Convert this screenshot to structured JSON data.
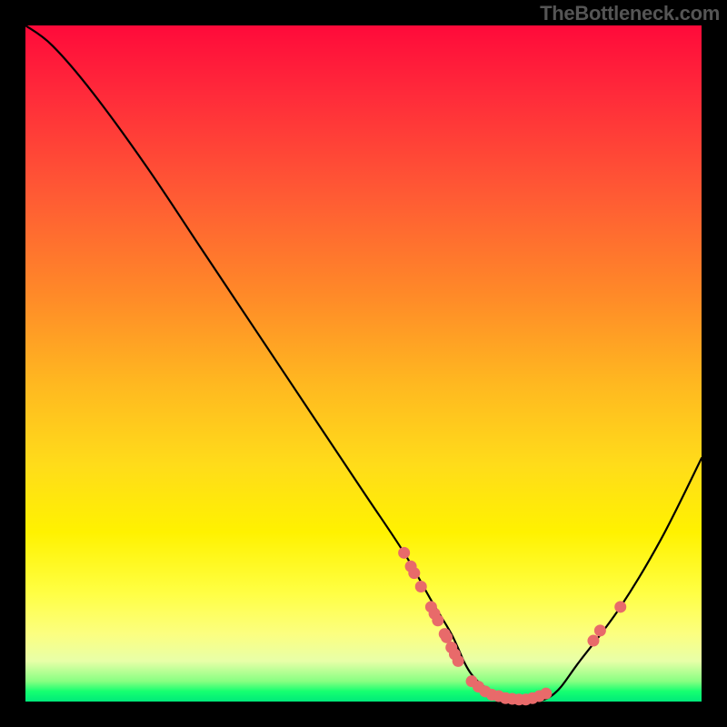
{
  "watermark": "TheBottleneck.com",
  "chart_data": {
    "type": "line",
    "title": "",
    "xlabel": "",
    "ylabel": "",
    "xlim": [
      0,
      100
    ],
    "ylim": [
      0,
      100
    ],
    "curve": {
      "x": [
        0,
        4,
        10,
        18,
        26,
        34,
        42,
        50,
        56,
        60,
        63,
        66,
        70,
        74,
        78,
        82,
        88,
        94,
        100
      ],
      "y": [
        100,
        97,
        90,
        79,
        67,
        55,
        43,
        31,
        22,
        15,
        10,
        4,
        1,
        0,
        1,
        6,
        14,
        24,
        36
      ]
    },
    "markers": [
      {
        "x": 56,
        "y": 22
      },
      {
        "x": 57,
        "y": 20
      },
      {
        "x": 57.5,
        "y": 19
      },
      {
        "x": 58.5,
        "y": 17
      },
      {
        "x": 60,
        "y": 14
      },
      {
        "x": 60.5,
        "y": 13
      },
      {
        "x": 61,
        "y": 12
      },
      {
        "x": 62,
        "y": 10
      },
      {
        "x": 62.3,
        "y": 9.5
      },
      {
        "x": 63,
        "y": 8
      },
      {
        "x": 63.5,
        "y": 7
      },
      {
        "x": 64,
        "y": 6
      },
      {
        "x": 66,
        "y": 3
      },
      {
        "x": 67,
        "y": 2.2
      },
      {
        "x": 68,
        "y": 1.5
      },
      {
        "x": 69,
        "y": 1
      },
      {
        "x": 70,
        "y": 0.8
      },
      {
        "x": 71,
        "y": 0.5
      },
      {
        "x": 72,
        "y": 0.4
      },
      {
        "x": 73,
        "y": 0.3
      },
      {
        "x": 74,
        "y": 0.3
      },
      {
        "x": 75,
        "y": 0.5
      },
      {
        "x": 76,
        "y": 0.8
      },
      {
        "x": 77,
        "y": 1.2
      },
      {
        "x": 84,
        "y": 9
      },
      {
        "x": 85,
        "y": 10.5
      },
      {
        "x": 88,
        "y": 14
      }
    ],
    "colors": {
      "curve": "#000000",
      "marker_fill": "#e86a6a",
      "marker_stroke": "#c94f4f"
    }
  }
}
